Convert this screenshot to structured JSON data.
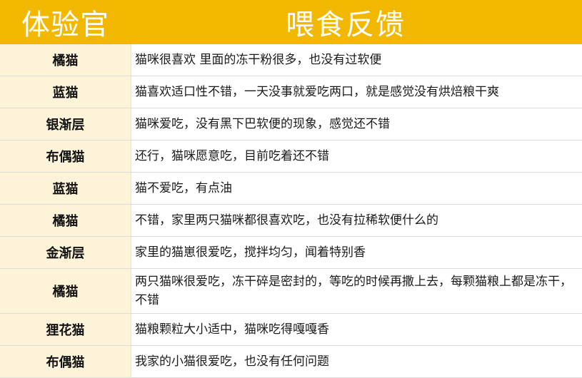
{
  "header": {
    "col1": "体验官",
    "col2": "喂食反馈"
  },
  "rows": [
    {
      "name": "橘猫",
      "feedback": "猫咪很喜欢  里面的冻干粉很多，也没有过软便"
    },
    {
      "name": "蓝猫",
      "feedback": "猫喜欢适口性不错，一天没事就爱吃两口，就是感觉没有烘焙粮干爽"
    },
    {
      "name": "银渐层",
      "feedback": "猫咪爱吃，没有黑下巴软便的现象，感觉还不错"
    },
    {
      "name": "布偶猫",
      "feedback": "还行，猫咪愿意吃，目前吃着还不错"
    },
    {
      "name": "蓝猫",
      "feedback": "猫不爱吃，有点油"
    },
    {
      "name": "橘猫",
      "feedback": "不错，家里两只猫咪都很喜欢吃，也没有拉稀软便什么的"
    },
    {
      "name": "金渐层",
      "feedback": "家里的猫崽很爱吃，搅拌均匀，闻着特别香"
    },
    {
      "name": "橘猫",
      "feedback": "两只猫咪很爱吃，冻干碎是密封的，等吃的时候再撒上去，每颗猫粮上都是冻干，不错"
    },
    {
      "name": "狸花猫",
      "feedback": "猫粮颗粒大小适中，猫咪吃得嘎嘎香"
    },
    {
      "name": "布偶猫",
      "feedback": "我家的小猫很爱吃，也没有任何问题"
    }
  ],
  "colors": {
    "header_bg": "#f2b800",
    "name_bg": "#fdf3d8"
  }
}
